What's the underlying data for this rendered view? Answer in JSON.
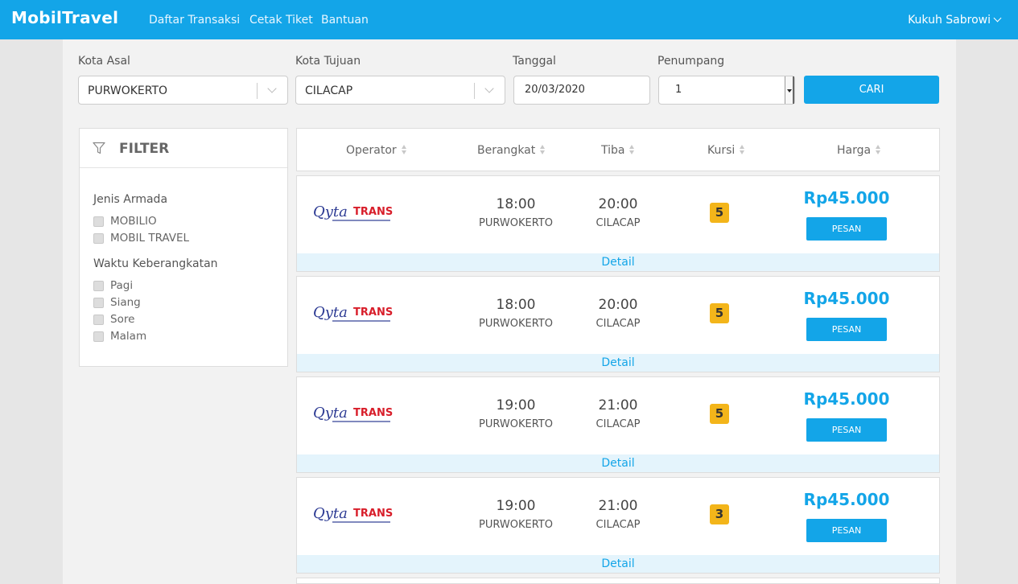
{
  "navbar": {
    "logo": "MobilTravel",
    "links": [
      "Daftar Transaksi",
      "Cetak Tiket",
      "Bantuan"
    ],
    "user": "Kukuh Sabrowi",
    "user_icon": "chevron-down-icon"
  },
  "search": {
    "origin_label": "Kota Asal",
    "origin_value": "PURWOKERTO",
    "dest_label": "Kota Tujuan",
    "dest_value": "CILACAP",
    "date_label": "Tanggal",
    "date_value": "20/03/2020",
    "pax_label": "Penumpang",
    "pax_value": "1",
    "search_button": "CARI"
  },
  "filter": {
    "title": "FILTER",
    "icon": "filter-icon",
    "groups": [
      {
        "title": "Jenis Armada",
        "options": [
          "MOBILIO",
          "MOBIL TRAVEL"
        ]
      },
      {
        "title": "Waktu Keberangkatan",
        "options": [
          "Pagi",
          "Siang",
          "Sore",
          "Malam"
        ]
      }
    ]
  },
  "table_header": {
    "columns": [
      "Operator",
      "Berangkat",
      "Tiba",
      "Kursi",
      "Harga"
    ]
  },
  "trips": [
    {
      "operator": "Qyta TRANS",
      "depart_time": "18:00",
      "depart_city": "PURWOKERTO",
      "arrive_time": "20:00",
      "arrive_city": "CILACAP",
      "seats": "5",
      "price": "Rp45.000",
      "book_label": "PESAN",
      "detail_label": "Detail"
    },
    {
      "operator": "Qyta TRANS",
      "depart_time": "18:00",
      "depart_city": "PURWOKERTO",
      "arrive_time": "20:00",
      "arrive_city": "CILACAP",
      "seats": "5",
      "price": "Rp45.000",
      "book_label": "PESAN",
      "detail_label": "Detail"
    },
    {
      "operator": "Qyta TRANS",
      "depart_time": "19:00",
      "depart_city": "PURWOKERTO",
      "arrive_time": "21:00",
      "arrive_city": "CILACAP",
      "seats": "5",
      "price": "Rp45.000",
      "book_label": "PESAN",
      "detail_label": "Detail"
    },
    {
      "operator": "Qyta TRANS",
      "depart_time": "19:00",
      "depart_city": "PURWOKERTO",
      "arrive_time": "21:00",
      "arrive_city": "CILACAP",
      "seats": "3",
      "price": "Rp45.000",
      "book_label": "PESAN",
      "detail_label": "Detail"
    }
  ],
  "colors": {
    "accent": "#13a5e8",
    "seat_badge": "#f3b51a",
    "detail_bg": "#e4f4fc"
  }
}
